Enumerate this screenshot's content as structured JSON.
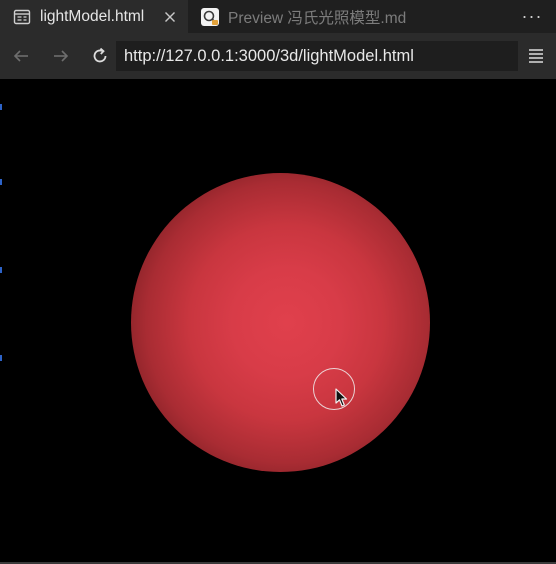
{
  "tabs": [
    {
      "label": "lightModel.html",
      "active": true,
      "icon": "html-file-icon"
    },
    {
      "label": "Preview 冯氏光照模型.md",
      "active": false,
      "icon": "preview-icon"
    }
  ],
  "toolbar": {
    "more_label": "···"
  },
  "navbar": {
    "url": "http://127.0.0.1:3000/3d/lightModel.html",
    "back_icon": "back-arrow-icon",
    "forward_icon": "forward-arrow-icon",
    "reload_icon": "reload-icon",
    "menu_icon": "menu-icon"
  },
  "scene": {
    "object": "sphere",
    "sphere_color": "#e0404c",
    "background_color": "#000000"
  },
  "colors": {
    "tab_bar": "#1f1f1f",
    "nav_bar": "#2b2b2b",
    "url_box": "#1e1e1e"
  }
}
